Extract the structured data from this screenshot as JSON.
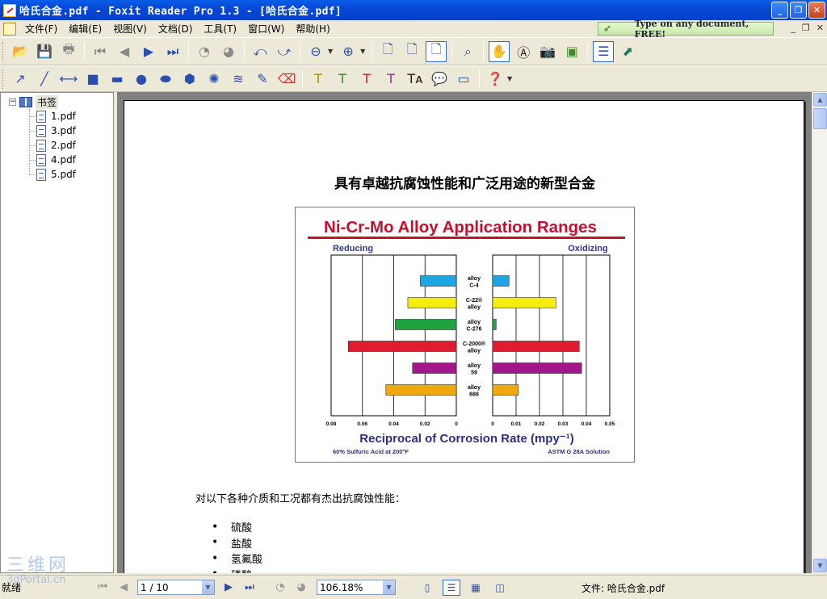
{
  "window": {
    "title": "哈氏合金.pdf - Foxit Reader Pro 1.3 - [哈氏合金.pdf]",
    "buttons": {
      "minimize": "_",
      "restore": "❐",
      "close": "✕"
    }
  },
  "menu": {
    "items": [
      "文件(F)",
      "编辑(E)",
      "视图(V)",
      "文档(D)",
      "工具(T)",
      "窗口(W)",
      "帮助(H)"
    ],
    "promo": "Type on any document, FREE!",
    "mdi": {
      "minimize": "_",
      "restore": "❐",
      "close": "✕"
    }
  },
  "bookmarks": {
    "root": "书签",
    "expander": "−",
    "items": [
      "1.pdf",
      "3.pdf",
      "2.pdf",
      "4.pdf",
      "5.pdf"
    ]
  },
  "document": {
    "heading": "具有卓越抗腐蚀性能和广泛用途的新型合金",
    "intro": "对以下各种介质和工况都有杰出抗腐蚀性能：",
    "bullets": [
      "硫酸",
      "盐酸",
      "氢氟酸",
      "磷酸"
    ]
  },
  "chart_data": {
    "type": "bar",
    "title": "Ni-Cr-Mo Alloy Application Ranges",
    "xlabel": "Reciprocal of Corrosion Rate (mpy⁻¹)",
    "left_panel_label": "Reducing",
    "right_panel_label": "Oxidizing",
    "left_footnote": "60% Sulfuric Acid at 200°F",
    "right_footnote": "ASTM G 28A Solution",
    "categories": [
      "alloy C-4",
      "C-22® alloy",
      "alloy C-276",
      "C-2000® alloy",
      "alloy 59",
      "alloy 686"
    ],
    "category_lines": [
      [
        "alloy",
        "C-4"
      ],
      [
        "C-22®",
        "alloy"
      ],
      [
        "alloy",
        "C-276"
      ],
      [
        "C-2000®",
        "alloy"
      ],
      [
        "alloy",
        "59"
      ],
      [
        "alloy",
        "686"
      ]
    ],
    "colors": [
      "#1ea5e4",
      "#f2ee12",
      "#1ea33e",
      "#e01b2e",
      "#a3158a",
      "#f0a810"
    ],
    "series": [
      {
        "name": "Reducing",
        "values": [
          0.023,
          0.031,
          0.039,
          0.069,
          0.028,
          0.045
        ]
      },
      {
        "name": "Oxidizing",
        "values": [
          0.007,
          0.027,
          0.0015,
          0.037,
          0.038,
          0.011
        ]
      }
    ],
    "left_xlim": [
      0.08,
      0
    ],
    "left_ticks": [
      "0.08",
      "0.06",
      "0.04",
      "0.02",
      "0"
    ],
    "right_xlim": [
      0,
      0.05
    ],
    "right_ticks": [
      "0",
      "0.01",
      "0.02",
      "0.03",
      "0.04",
      "0.05"
    ],
    "grid": true
  },
  "status": {
    "ready": "就绪",
    "page": "1 / 10",
    "zoom": "106.18%",
    "file": "文件: 哈氏合金.pdf"
  },
  "watermark": {
    "line1": "三维网",
    "line2": "3dPortal.cn"
  }
}
